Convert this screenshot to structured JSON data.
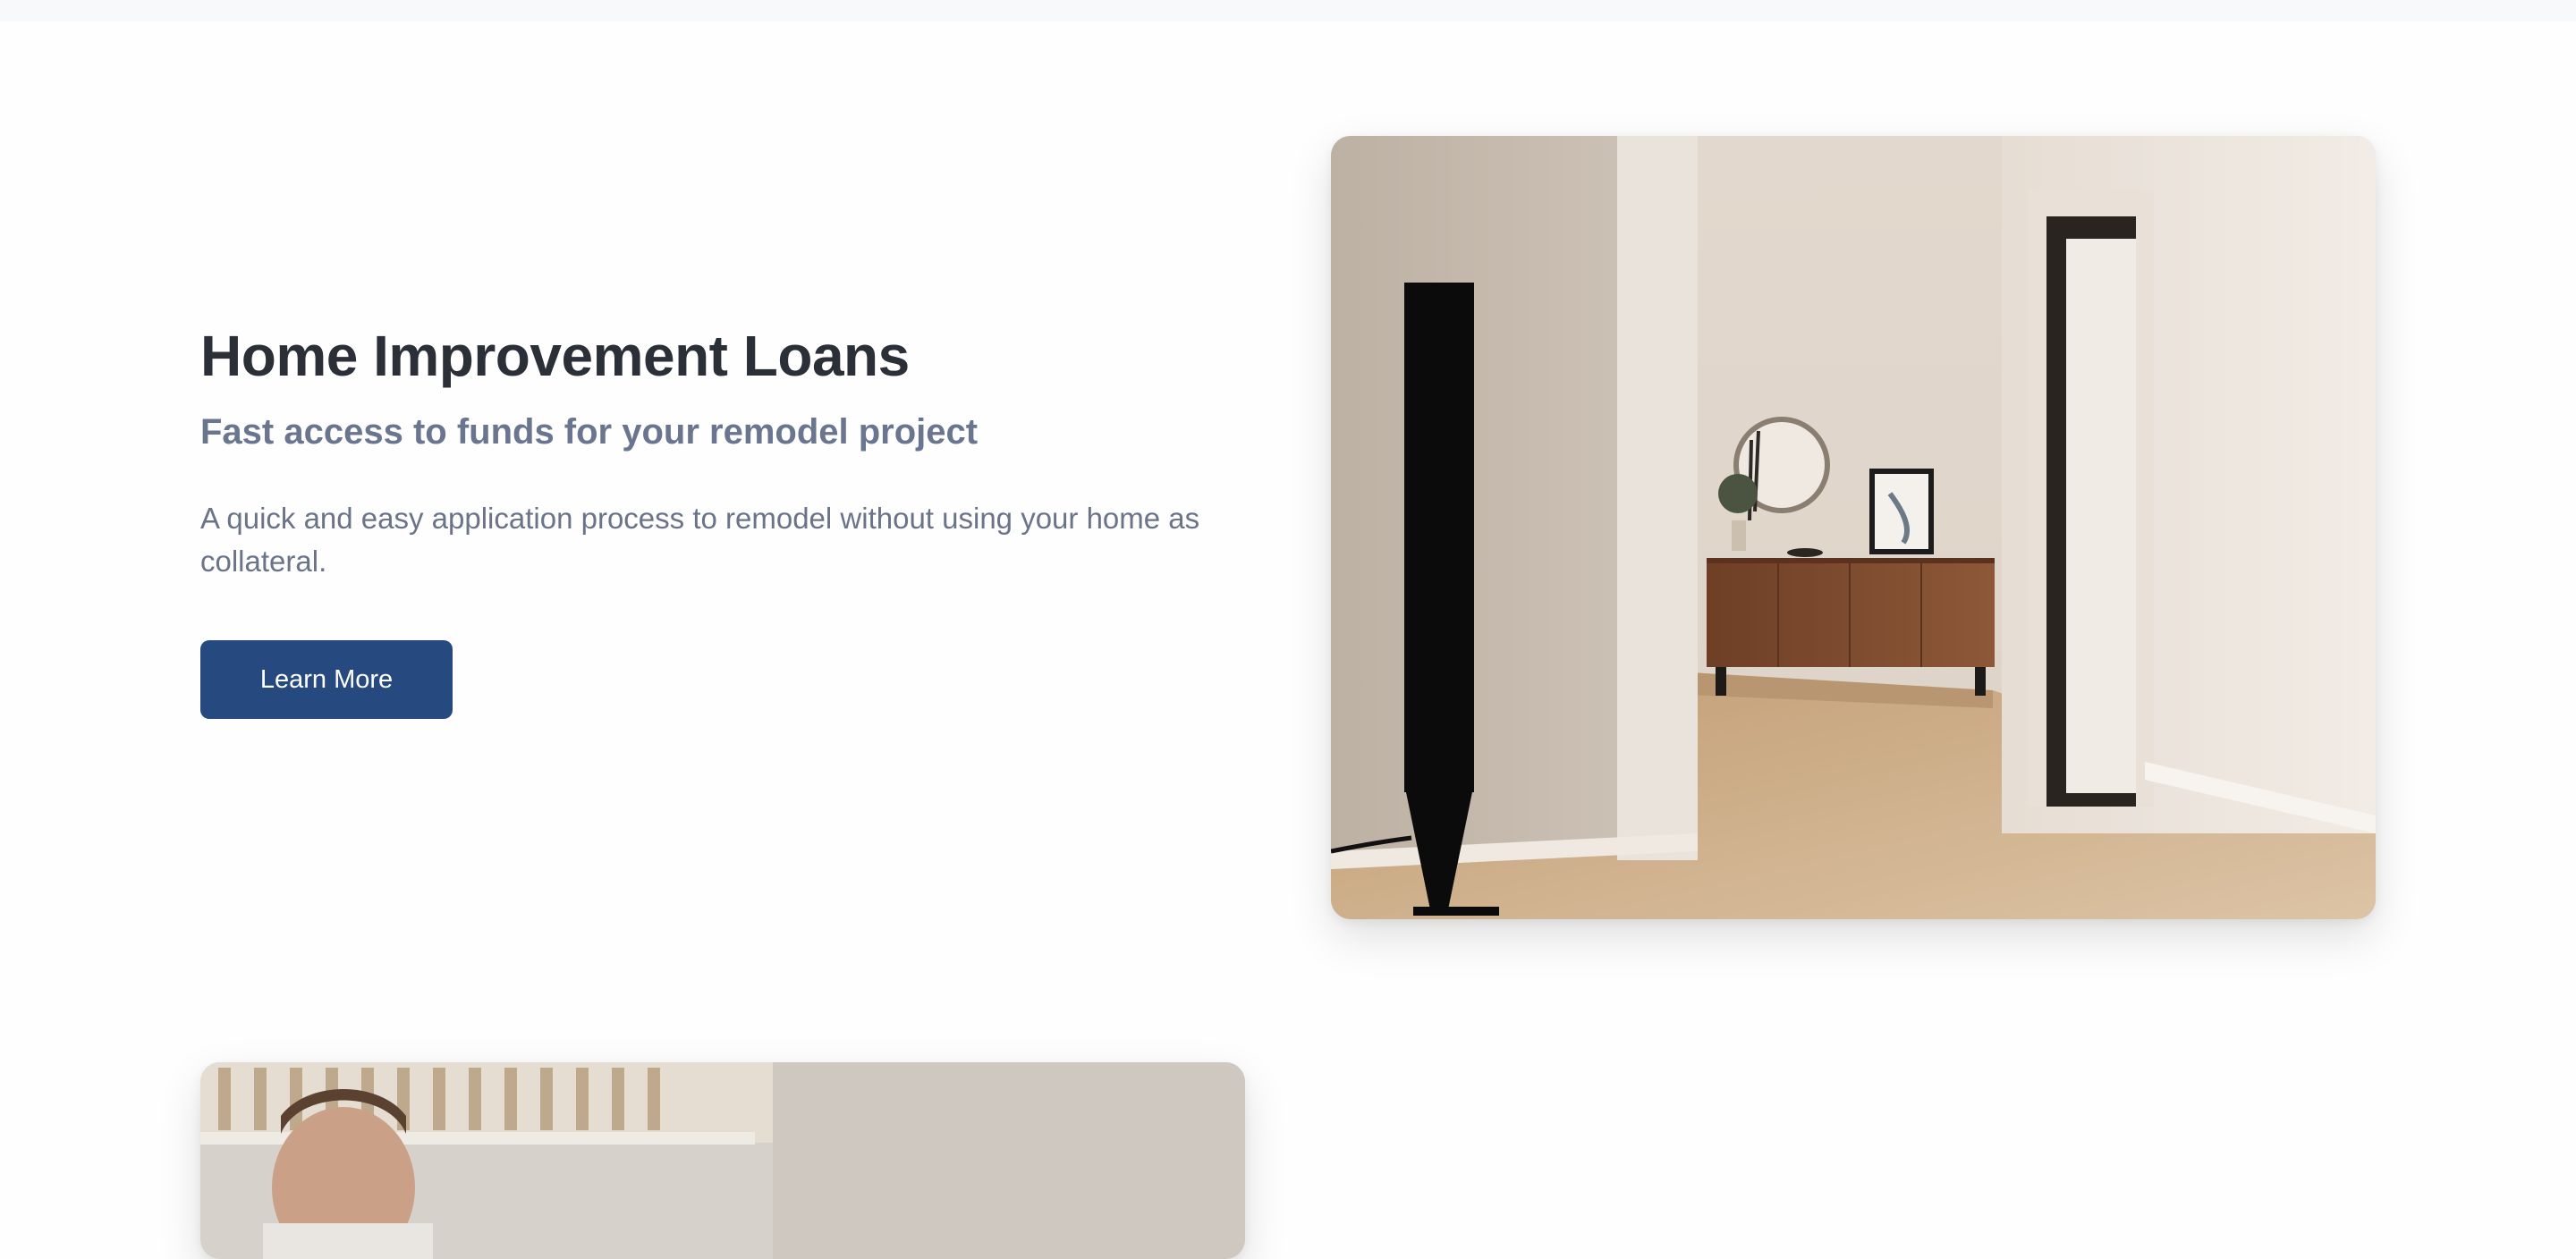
{
  "hero": {
    "title": "Home Improvement Loans",
    "subtitle": "Fast access to funds for your remodel project",
    "description": "A quick and easy application process to remodel without using your home as collateral.",
    "cta_label": "Learn More",
    "image_icon": "living-room-photo"
  },
  "next_section": {
    "image_icon": "person-photo"
  },
  "colors": {
    "title": "#2b2f38",
    "subtitle": "#6a7690",
    "body": "#6a7388",
    "button_bg": "#264a80",
    "button_text": "#ffffff"
  }
}
